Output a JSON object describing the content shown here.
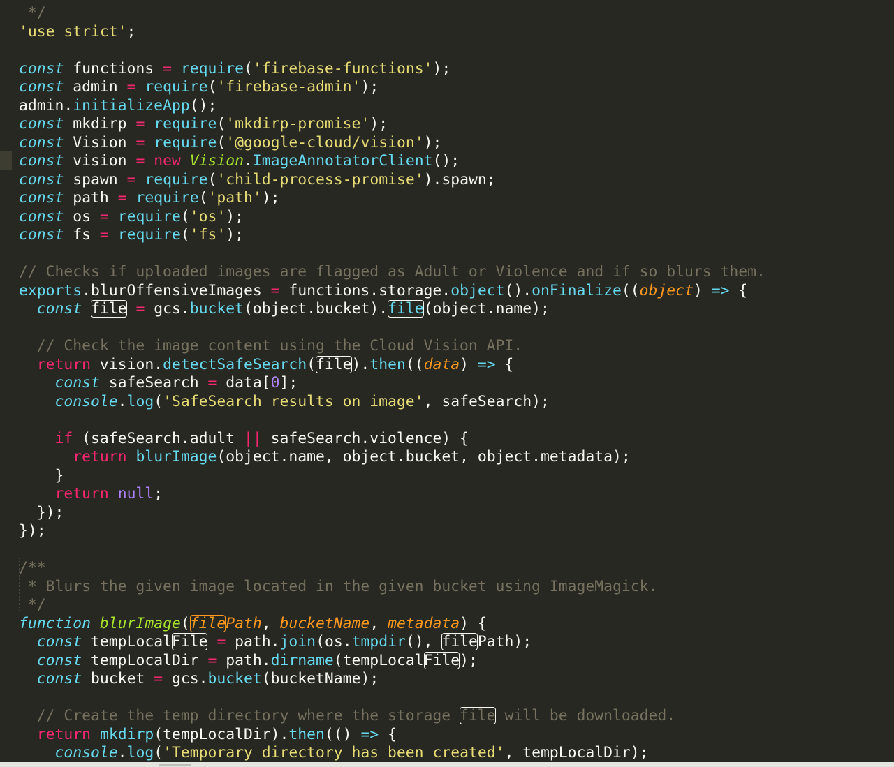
{
  "editor": {
    "theme_colors": {
      "background": "#272822",
      "keyword": "#66d9ef",
      "operator": "#f92672",
      "string": "#e6db74",
      "comment": "#75715e",
      "parameter": "#fd971f",
      "number": "#ae81ff",
      "text": "#f8f8f2"
    },
    "lines": [
      [
        [
          "cm",
          " */"
        ]
      ],
      [
        [
          "str",
          "'use strict'"
        ],
        [
          "tok",
          ";"
        ]
      ],
      [],
      [
        [
          "kw",
          "const"
        ],
        [
          "tok",
          " functions "
        ],
        [
          "op",
          "="
        ],
        [
          "tok",
          " "
        ],
        [
          "fn",
          "require"
        ],
        [
          "tok",
          "("
        ],
        [
          "str",
          "'firebase-functions'"
        ],
        [
          "tok",
          ");"
        ]
      ],
      [
        [
          "kw",
          "const"
        ],
        [
          "tok",
          " admin "
        ],
        [
          "op",
          "="
        ],
        [
          "tok",
          " "
        ],
        [
          "fn",
          "require"
        ],
        [
          "tok",
          "("
        ],
        [
          "str",
          "'firebase-admin'"
        ],
        [
          "tok",
          ");"
        ]
      ],
      [
        [
          "tok",
          "admin."
        ],
        [
          "fn",
          "initializeApp"
        ],
        [
          "tok",
          "();"
        ]
      ],
      [
        [
          "kw",
          "const"
        ],
        [
          "tok",
          " mkdirp "
        ],
        [
          "op",
          "="
        ],
        [
          "tok",
          " "
        ],
        [
          "fn",
          "require"
        ],
        [
          "tok",
          "("
        ],
        [
          "str",
          "'mkdirp-promise'"
        ],
        [
          "tok",
          ");"
        ]
      ],
      [
        [
          "kw",
          "const"
        ],
        [
          "tok",
          " Vision "
        ],
        [
          "op",
          "="
        ],
        [
          "tok",
          " "
        ],
        [
          "fn",
          "require"
        ],
        [
          "tok",
          "("
        ],
        [
          "str",
          "'@google-cloud/vision'"
        ],
        [
          "tok",
          ");"
        ]
      ],
      [
        [
          "kw",
          "const"
        ],
        [
          "tok",
          " vision "
        ],
        [
          "op",
          "="
        ],
        [
          "tok",
          " "
        ],
        [
          "red",
          "new"
        ],
        [
          "tok",
          " "
        ],
        [
          "cls",
          "Vision"
        ],
        [
          "tok",
          "."
        ],
        [
          "fn",
          "ImageAnnotatorClient"
        ],
        [
          "tok",
          "();"
        ]
      ],
      [
        [
          "kw",
          "const"
        ],
        [
          "tok",
          " spawn "
        ],
        [
          "op",
          "="
        ],
        [
          "tok",
          " "
        ],
        [
          "fn",
          "require"
        ],
        [
          "tok",
          "("
        ],
        [
          "str",
          "'child-process-promise'"
        ],
        [
          "tok",
          ").spawn;"
        ]
      ],
      [
        [
          "kw",
          "const"
        ],
        [
          "tok",
          " path "
        ],
        [
          "op",
          "="
        ],
        [
          "tok",
          " "
        ],
        [
          "fn",
          "require"
        ],
        [
          "tok",
          "("
        ],
        [
          "str",
          "'path'"
        ],
        [
          "tok",
          ");"
        ]
      ],
      [
        [
          "kw",
          "const"
        ],
        [
          "tok",
          " os "
        ],
        [
          "op",
          "="
        ],
        [
          "tok",
          " "
        ],
        [
          "fn",
          "require"
        ],
        [
          "tok",
          "("
        ],
        [
          "str",
          "'os'"
        ],
        [
          "tok",
          ");"
        ]
      ],
      [
        [
          "kw",
          "const"
        ],
        [
          "tok",
          " fs "
        ],
        [
          "op",
          "="
        ],
        [
          "tok",
          " "
        ],
        [
          "fn",
          "require"
        ],
        [
          "tok",
          "("
        ],
        [
          "str",
          "'fs'"
        ],
        [
          "tok",
          ");"
        ]
      ],
      [],
      [
        [
          "cm",
          "// Checks if uploaded images are flagged as Adult or Violence and if so blurs them."
        ]
      ],
      [
        [
          "fn",
          "exports"
        ],
        [
          "tok",
          ".blurOffensiveImages "
        ],
        [
          "op",
          "="
        ],
        [
          "tok",
          " functions.storage."
        ],
        [
          "fn",
          "object"
        ],
        [
          "tok",
          "()."
        ],
        [
          "fn",
          "onFinalize"
        ],
        [
          "tok",
          "(("
        ],
        [
          "prm",
          "object"
        ],
        [
          "tok",
          ") "
        ],
        [
          "fn",
          "=>"
        ],
        [
          "tok",
          " {"
        ]
      ],
      [
        [
          "tok",
          "  "
        ],
        [
          "kw",
          "const"
        ],
        [
          "tok",
          " "
        ],
        [
          "hl",
          "file"
        ],
        [
          "tok",
          " "
        ],
        [
          "op",
          "="
        ],
        [
          "tok",
          " gcs."
        ],
        [
          "fn",
          "bucket"
        ],
        [
          "tok",
          "(object.bucket)."
        ],
        [
          "hlfn",
          "file"
        ],
        [
          "tok",
          "(object.name);"
        ]
      ],
      [],
      [
        [
          "cm",
          "  // Check the image content using the Cloud Vision API."
        ]
      ],
      [
        [
          "tok",
          "  "
        ],
        [
          "red",
          "return"
        ],
        [
          "tok",
          " vision."
        ],
        [
          "fn",
          "detectSafeSearch"
        ],
        [
          "tok",
          "("
        ],
        [
          "hl",
          "file"
        ],
        [
          "tok",
          ")."
        ],
        [
          "fn",
          "then"
        ],
        [
          "tok",
          "(("
        ],
        [
          "prm",
          "data"
        ],
        [
          "tok",
          ") "
        ],
        [
          "fn",
          "=>"
        ],
        [
          "tok",
          " {"
        ]
      ],
      [
        [
          "tok",
          "    "
        ],
        [
          "kw",
          "const"
        ],
        [
          "tok",
          " safeSearch "
        ],
        [
          "op",
          "="
        ],
        [
          "tok",
          " data["
        ],
        [
          "num",
          "0"
        ],
        [
          "tok",
          "];"
        ]
      ],
      [
        [
          "tok",
          "    "
        ],
        [
          "kw",
          "console"
        ],
        [
          "tok",
          "."
        ],
        [
          "fn",
          "log"
        ],
        [
          "tok",
          "("
        ],
        [
          "str",
          "'SafeSearch results on image'"
        ],
        [
          "tok",
          ", safeSearch);"
        ]
      ],
      [],
      [
        [
          "tok",
          "    "
        ],
        [
          "red",
          "if"
        ],
        [
          "tok",
          " (safeSearch.adult "
        ],
        [
          "op",
          "||"
        ],
        [
          "tok",
          " safeSearch.violence) {"
        ]
      ],
      [
        [
          "tok",
          "      "
        ],
        [
          "red",
          "return"
        ],
        [
          "tok",
          " "
        ],
        [
          "fn",
          "blurImage"
        ],
        [
          "tok",
          "(object.name, object.bucket, object.metadata);"
        ]
      ],
      [
        [
          "tok",
          "    }"
        ]
      ],
      [
        [
          "tok",
          "    "
        ],
        [
          "red",
          "return"
        ],
        [
          "tok",
          " "
        ],
        [
          "num",
          "null"
        ],
        [
          "tok",
          ";"
        ]
      ],
      [
        [
          "tok",
          "  });"
        ]
      ],
      [
        [
          "tok",
          "});"
        ]
      ],
      [],
      [
        [
          "cm",
          "/**"
        ]
      ],
      [
        [
          "cm",
          " * Blurs the given image located in the given bucket using ImageMagick."
        ]
      ],
      [
        [
          "cm",
          " */"
        ]
      ],
      [
        [
          "kw",
          "function"
        ],
        [
          "tok",
          " "
        ],
        [
          "cls",
          "blurImage"
        ],
        [
          "tok",
          "("
        ],
        [
          "hlprm",
          "file"
        ],
        [
          "prm",
          "Path"
        ],
        [
          "tok",
          ", "
        ],
        [
          "prm",
          "bucketName"
        ],
        [
          "tok",
          ", "
        ],
        [
          "prm",
          "metadata"
        ],
        [
          "tok",
          ") {"
        ]
      ],
      [
        [
          "tok",
          "  "
        ],
        [
          "kw",
          "const"
        ],
        [
          "tok",
          " tempLocal"
        ],
        [
          "hl",
          "File"
        ],
        [
          "tok",
          " "
        ],
        [
          "op",
          "="
        ],
        [
          "tok",
          " path."
        ],
        [
          "fn",
          "join"
        ],
        [
          "tok",
          "(os."
        ],
        [
          "fn",
          "tmpdir"
        ],
        [
          "tok",
          "(), "
        ],
        [
          "hl",
          "file"
        ],
        [
          "tok",
          "Path);"
        ]
      ],
      [
        [
          "tok",
          "  "
        ],
        [
          "kw",
          "const"
        ],
        [
          "tok",
          " tempLocalDir "
        ],
        [
          "op",
          "="
        ],
        [
          "tok",
          " path."
        ],
        [
          "fn",
          "dirname"
        ],
        [
          "tok",
          "(tempLocal"
        ],
        [
          "hl",
          "File"
        ],
        [
          "tok",
          ");"
        ]
      ],
      [
        [
          "tok",
          "  "
        ],
        [
          "kw",
          "const"
        ],
        [
          "tok",
          " bucket "
        ],
        [
          "op",
          "="
        ],
        [
          "tok",
          " gcs."
        ],
        [
          "fn",
          "bucket"
        ],
        [
          "tok",
          "(bucketName);"
        ]
      ],
      [],
      [
        [
          "cm",
          "  // Create the temp directory where the storage "
        ],
        [
          "hlcm",
          "file"
        ],
        [
          "cm",
          " will be downloaded."
        ]
      ],
      [
        [
          "tok",
          "  "
        ],
        [
          "red",
          "return"
        ],
        [
          "tok",
          " "
        ],
        [
          "fn",
          "mkdirp"
        ],
        [
          "tok",
          "(tempLocalDir)."
        ],
        [
          "fn",
          "then"
        ],
        [
          "tok",
          "(() "
        ],
        [
          "fn",
          "=>"
        ],
        [
          "tok",
          " {"
        ]
      ],
      [
        [
          "tok",
          "    "
        ],
        [
          "kw",
          "console"
        ],
        [
          "tok",
          "."
        ],
        [
          "fn",
          "log"
        ],
        [
          "tok",
          "("
        ],
        [
          "str",
          "'Temporary directory has been created'"
        ],
        [
          "tok",
          ", tempLocalDir);"
        ]
      ]
    ]
  }
}
